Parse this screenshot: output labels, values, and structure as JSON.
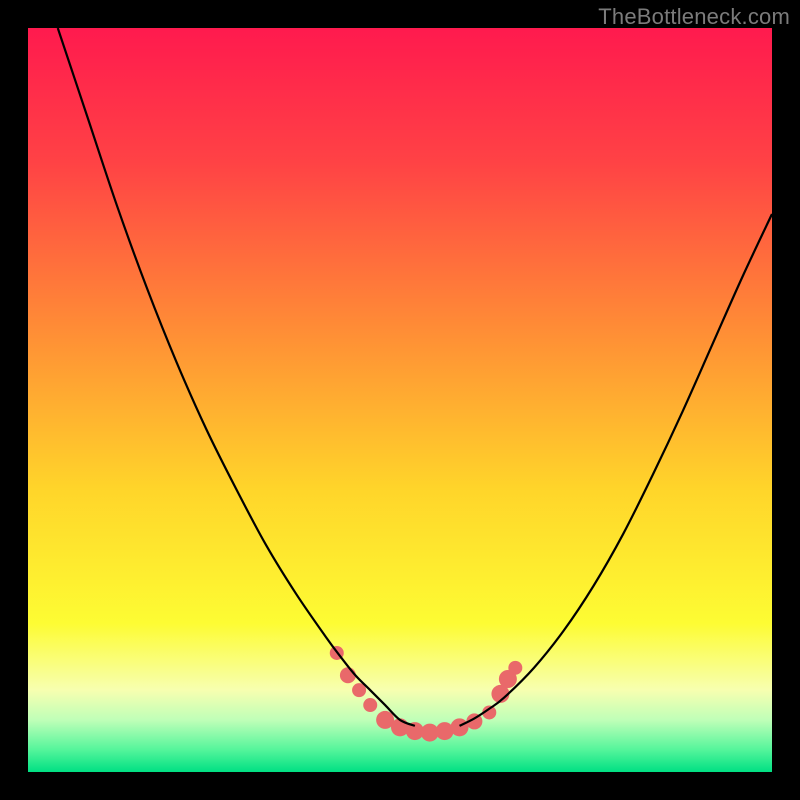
{
  "watermark": "TheBottleneck.com",
  "chart_data": {
    "type": "line",
    "title": "",
    "xlabel": "",
    "ylabel": "",
    "xlim": [
      0,
      100
    ],
    "ylim": [
      0,
      100
    ],
    "grid": false,
    "legend": false,
    "background_gradient_stops": [
      {
        "offset": 0.0,
        "color": "#ff1a4e"
      },
      {
        "offset": 0.18,
        "color": "#ff4245"
      },
      {
        "offset": 0.4,
        "color": "#ff8b36"
      },
      {
        "offset": 0.62,
        "color": "#ffd52a"
      },
      {
        "offset": 0.8,
        "color": "#fdfc33"
      },
      {
        "offset": 0.89,
        "color": "#f7ffb0"
      },
      {
        "offset": 0.93,
        "color": "#bfffb8"
      },
      {
        "offset": 0.97,
        "color": "#55f59b"
      },
      {
        "offset": 1.0,
        "color": "#00e083"
      }
    ],
    "series": [
      {
        "name": "left-curve",
        "x": [
          4.0,
          8.0,
          12.0,
          16.0,
          20.0,
          24.0,
          28.0,
          32.0,
          36.0,
          40.0,
          42.0,
          44.0,
          46.0,
          48.0,
          50.0,
          52.0
        ],
        "y": [
          100.0,
          88.0,
          76.0,
          65.0,
          55.0,
          46.0,
          38.0,
          30.5,
          24.0,
          18.2,
          15.5,
          13.0,
          11.0,
          9.0,
          7.0,
          6.2
        ]
      },
      {
        "name": "right-curve",
        "x": [
          58.0,
          60.0,
          62.0,
          64.0,
          68.0,
          72.0,
          76.0,
          80.0,
          84.0,
          88.0,
          92.0,
          96.0,
          100.0
        ],
        "y": [
          6.2,
          7.2,
          8.5,
          10.0,
          14.0,
          19.0,
          25.0,
          32.0,
          40.0,
          48.5,
          57.5,
          66.5,
          75.0
        ]
      }
    ],
    "markers": {
      "name": "bottom-dots",
      "color": "#e9696a",
      "points": [
        {
          "x": 41.5,
          "y": 16.0,
          "r": 7
        },
        {
          "x": 43.0,
          "y": 13.0,
          "r": 8
        },
        {
          "x": 44.5,
          "y": 11.0,
          "r": 7
        },
        {
          "x": 46.0,
          "y": 9.0,
          "r": 7
        },
        {
          "x": 48.0,
          "y": 7.0,
          "r": 9
        },
        {
          "x": 50.0,
          "y": 6.0,
          "r": 9
        },
        {
          "x": 52.0,
          "y": 5.5,
          "r": 9
        },
        {
          "x": 54.0,
          "y": 5.3,
          "r": 9
        },
        {
          "x": 56.0,
          "y": 5.5,
          "r": 9
        },
        {
          "x": 58.0,
          "y": 6.0,
          "r": 9
        },
        {
          "x": 60.0,
          "y": 6.8,
          "r": 8
        },
        {
          "x": 62.0,
          "y": 8.0,
          "r": 7
        },
        {
          "x": 63.5,
          "y": 10.5,
          "r": 9
        },
        {
          "x": 64.5,
          "y": 12.5,
          "r": 9
        },
        {
          "x": 65.5,
          "y": 14.0,
          "r": 7
        }
      ]
    }
  }
}
